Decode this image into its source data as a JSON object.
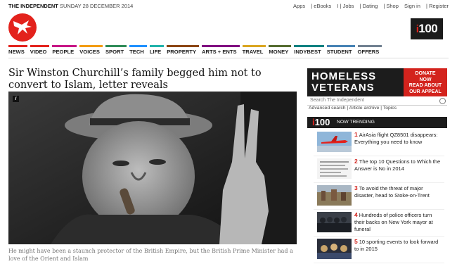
{
  "topbar": {
    "brand": "THE INDEPENDENT",
    "date": "SUNDAY 28 DECEMBER 2014",
    "links": [
      "Apps",
      "| eBooks",
      "I | Jobs",
      "| Dating",
      "| Shop",
      "Sign in",
      "| Register"
    ]
  },
  "i100": {
    "prefix": "i",
    "num": "100"
  },
  "nav": [
    {
      "label": "NEWS",
      "color": "#e3221c"
    },
    {
      "label": "VIDEO",
      "color": "#e3221c"
    },
    {
      "label": "PEOPLE",
      "color": "#c71585"
    },
    {
      "label": "VOICES",
      "color": "#f39c12"
    },
    {
      "label": "SPORT",
      "color": "#2e8b57"
    },
    {
      "label": "TECH",
      "color": "#1e90ff"
    },
    {
      "label": "LIFE",
      "color": "#20b2aa"
    },
    {
      "label": "PROPERTY",
      "color": "#8b4513"
    },
    {
      "label": "ARTS + ENTS",
      "color": "#800080"
    },
    {
      "label": "TRAVEL",
      "color": "#daa520"
    },
    {
      "label": "MONEY",
      "color": "#556b2f"
    },
    {
      "label": "INDYBEST",
      "color": "#008080"
    },
    {
      "label": "STUDENT",
      "color": "#4682b4"
    },
    {
      "label": "OFFERS",
      "color": "#708090"
    }
  ],
  "article": {
    "headline": "Sir Winston Churchill’s family begged him not to convert to Islam, letter reveals",
    "info_icon": "i",
    "caption": "He might have been a staunch protector of the British Empire, but the British Prime Minister had a love of the Orient and Islam"
  },
  "ad": {
    "line1": "HOMELESS",
    "line2": "VETERANS",
    "cta1": "DONATE",
    "cta2": "NOW",
    "cta3": "READ ABOUT",
    "cta4": "OUR APPEAL"
  },
  "search": {
    "placeholder": "Search The Independent",
    "links": "Advanced search | Article archive | Topics"
  },
  "trending": {
    "label": "NOW TRENDING",
    "items": [
      {
        "num": "1",
        "text": "AirAsia flight QZ8501 disappears: Everything you need to know"
      },
      {
        "num": "2",
        "text": "The top 10 Questions to Which the Answer is No in 2014"
      },
      {
        "num": "3",
        "text": "To avoid the threat of major disaster, head to Stoke-on-Trent"
      },
      {
        "num": "4",
        "text": "Hundreds of police officers turn their backs on New York mayor at funeral"
      },
      {
        "num": "5",
        "text": "10 sporting events to look forward to in 2015"
      }
    ]
  }
}
